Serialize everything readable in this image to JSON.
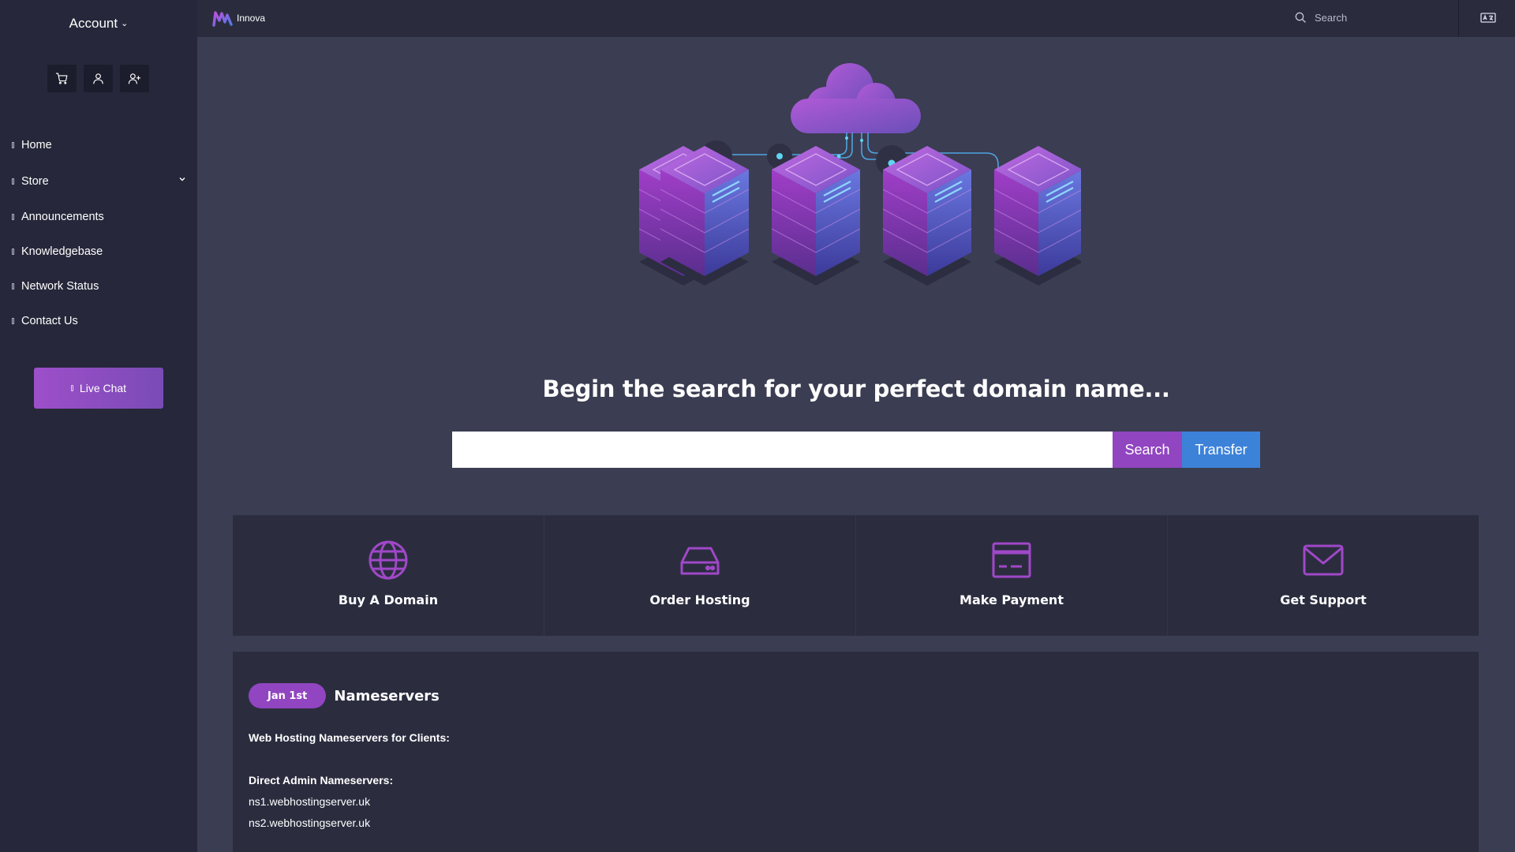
{
  "sidebar": {
    "account_label": "Account",
    "nav": [
      {
        "label": "Home"
      },
      {
        "label": "Store"
      },
      {
        "label": "Announcements"
      },
      {
        "label": "Knowledgebase"
      },
      {
        "label": "Network Status"
      },
      {
        "label": "Contact Us"
      }
    ],
    "live_chat_label": "Live Chat"
  },
  "topbar": {
    "brand": "Innova",
    "search_placeholder": "Search"
  },
  "hero": {
    "headline": "Begin the search for your perfect domain name...",
    "search_button": "Search",
    "transfer_button": "Transfer",
    "domain_value": ""
  },
  "tiles": [
    {
      "label": "Buy A Domain",
      "icon": "globe-icon"
    },
    {
      "label": "Order Hosting",
      "icon": "hard-drive-icon"
    },
    {
      "label": "Make Payment",
      "icon": "credit-card-icon"
    },
    {
      "label": "Get Support",
      "icon": "envelope-icon"
    }
  ],
  "announcement": {
    "date": "Jan 1st",
    "title": "Nameservers",
    "intro": "Web Hosting Nameservers for Clients:",
    "section_title": "Direct Admin Nameservers:",
    "ns1": "ns1.webhostingserver.uk",
    "ns2": "ns2.webhostingserver.uk"
  },
  "colors": {
    "accent_purple": "#9145c0",
    "accent_blue": "#3d82d9",
    "sidebar_bg": "#26273a",
    "main_bg": "#3b3d52",
    "card_bg": "#2b2d3f"
  }
}
